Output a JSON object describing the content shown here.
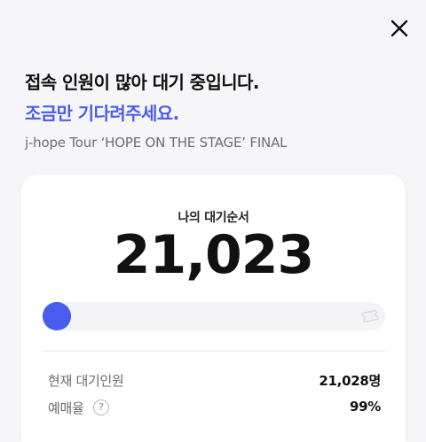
{
  "header": {
    "close_icon": "close-icon"
  },
  "message": {
    "headline": "접속 인원이 많아 대기 중입니다.",
    "subline": "조금만 기다려주세요.",
    "event_name": "j-hope Tour ‘HOPE ON THE STAGE’ FINAL"
  },
  "queue": {
    "label": "나의 대기순서",
    "number": "21,023",
    "progress_percent": 0,
    "ticket_icon": "ticket-icon"
  },
  "stats": {
    "waiting_label": "현재 대기인원",
    "waiting_value": "21,028명",
    "rate_label": "예매율",
    "rate_help": "?",
    "rate_value": "99%"
  },
  "colors": {
    "accent": "#4a5cf0",
    "track": "#f4f4f6",
    "background": "#f6f6f8"
  }
}
